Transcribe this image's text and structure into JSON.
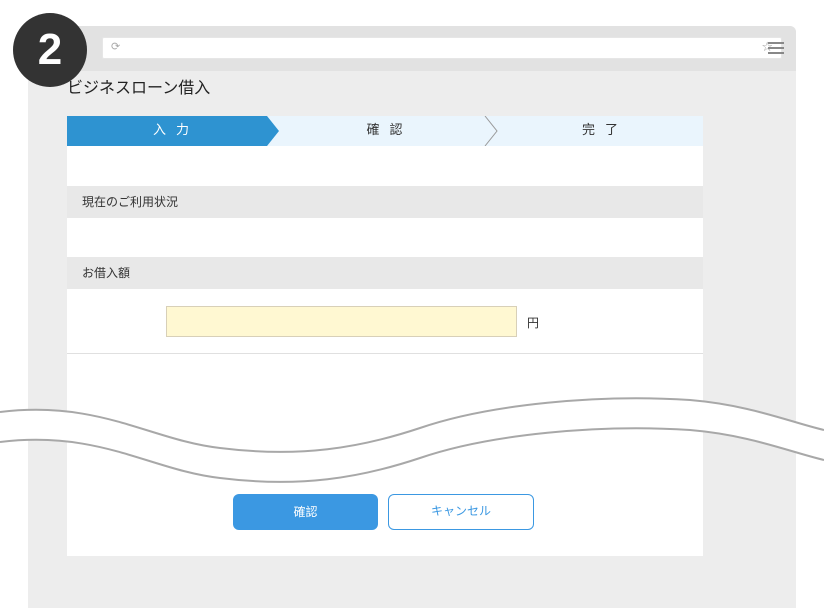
{
  "badge": {
    "number": "2"
  },
  "browser": {
    "reload_icon": "⟳",
    "star_icon": "☆"
  },
  "page": {
    "title": "ビジネスローン借入"
  },
  "steps": [
    {
      "label": "入力",
      "active": true
    },
    {
      "label": "確認",
      "active": false
    },
    {
      "label": "完了",
      "active": false
    }
  ],
  "sections": {
    "usage_title": "現在のご利用状況",
    "amount_title": "お借入額"
  },
  "amount": {
    "value": "",
    "unit": "円"
  },
  "buttons": {
    "confirm": "確認",
    "cancel": "キャンセル"
  },
  "colors": {
    "active_step": "#2e93d1",
    "inactive_step": "#eaf5fd",
    "primary_button": "#3b98e2",
    "input_bg": "#fff8d2"
  }
}
